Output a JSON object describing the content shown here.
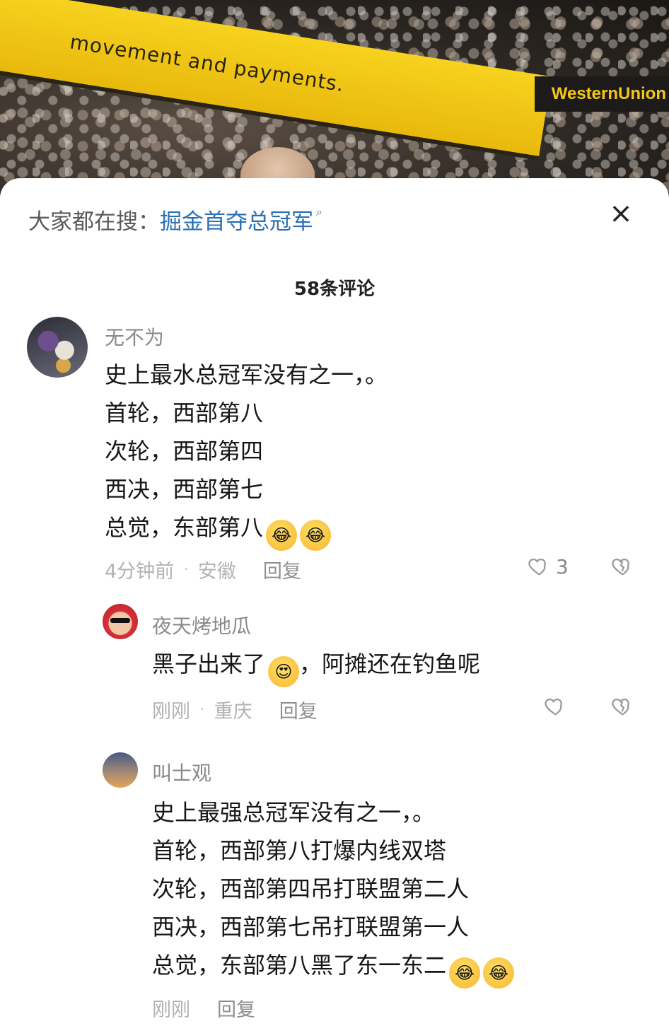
{
  "background": {
    "banner_text": "movement and payments.",
    "board_text": "WesternUnion"
  },
  "sheet": {
    "search_label": "大家都在搜：",
    "search_query": "掘金首夺总冠军",
    "comment_count": "58条评论"
  },
  "comments": [
    {
      "username": "无不为",
      "lines": [
        "史上最水总冠军没有之一，。",
        "首轮，西部第八",
        "次轮，西部第四",
        "西决，西部第七",
        "总觉，东部第八"
      ],
      "time": "4分钟前",
      "location": "安徽",
      "reply": "回复",
      "likes": "3"
    },
    {
      "username": "夜天烤地瓜",
      "line_before": "黑子出来了",
      "line_after": "，阿摊还在钓鱼呢",
      "time": "刚刚",
      "location": "重庆",
      "reply": "回复",
      "likes": ""
    },
    {
      "username": "叫士观",
      "lines": [
        "史上最强总冠军没有之一，。",
        "首轮，西部第八打爆内线双塔",
        "次轮，西部第四吊打联盟第二人",
        "西决，西部第七吊打联盟第一人",
        "总觉，东部第八黑了东一东二"
      ],
      "time": "刚刚",
      "reply": "回复"
    }
  ],
  "icons": {
    "laugh_emoji": "😂",
    "heart_eyes_emoji": "😍",
    "close": "×",
    "search": "⌕"
  }
}
